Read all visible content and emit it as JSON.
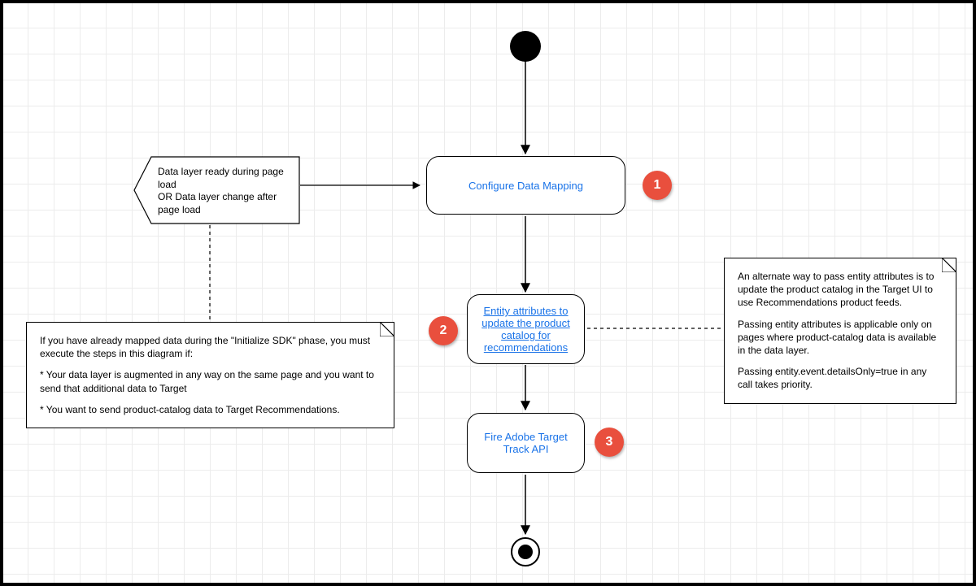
{
  "steps": {
    "configure": "Configure Data Mapping",
    "entity": "Entity attributes to update the product catalog for recommendations",
    "fire": "Fire Adobe Target Track API"
  },
  "badges": {
    "one": "1",
    "two": "2",
    "three": "3"
  },
  "signal_text": "Data layer ready during page load\nOR Data layer change after page load",
  "note_left_lines": [
    "If you have already mapped data during the \"Initialize SDK\" phase, you must execute the steps in this diagram if:",
    "",
    "* Your data layer is augmented in any way on the same page and you want to send that additional data to Target",
    "",
    "* You want to send product-catalog data to Target Recommendations."
  ],
  "note_right_lines": [
    "An alternate way to pass entity attributes is to update the product catalog in the Target UI to use Recommendations product feeds.",
    "",
    "Passing entity attributes is applicable only on pages where product-catalog data is available in the data layer.",
    "",
    "Passing entity.event.detailsOnly=true in any call takes priority."
  ]
}
